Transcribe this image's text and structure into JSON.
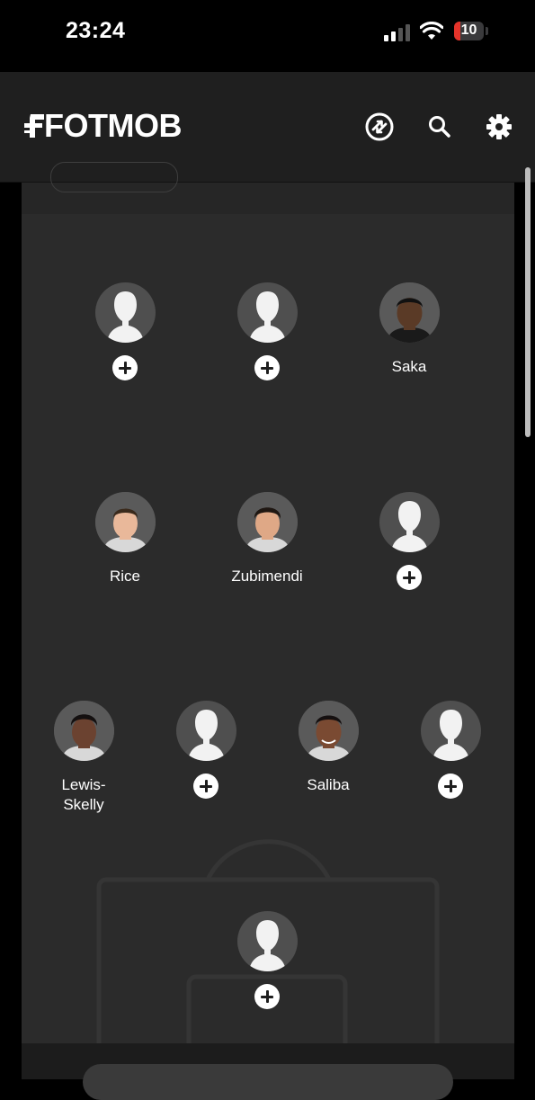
{
  "status_bar": {
    "time": "23:24",
    "battery_level": "10",
    "battery_color": "#e5332a",
    "signal_icon": "cellular-signal-icon",
    "wifi_icon": "wifi-icon"
  },
  "header": {
    "logo_text": "FOTMOB",
    "icons": [
      "transfer-swap-icon",
      "search-icon",
      "gear-icon"
    ]
  },
  "colors": {
    "background": "#000000",
    "header": "#1f1f1f",
    "pitch": "#2b2b2b",
    "avatar_placeholder": "#4f4f4f"
  },
  "lineup": {
    "attack": [
      {
        "name": "",
        "empty": true
      },
      {
        "name": "",
        "empty": true
      },
      {
        "name": "Saka",
        "empty": false,
        "skin": "#5a3a26"
      }
    ],
    "midfield": [
      {
        "name": "Rice",
        "empty": false,
        "skin": "#e9b89a"
      },
      {
        "name": "Zubimendi",
        "empty": false,
        "skin": "#dfa886"
      },
      {
        "name": "",
        "empty": true
      }
    ],
    "defence": [
      {
        "name": "Lewis-\nSkelly",
        "line1": "Lewis-",
        "line2": "Skelly",
        "empty": false,
        "skin": "#6b4230"
      },
      {
        "name": "",
        "empty": true
      },
      {
        "name": "Saliba",
        "empty": false,
        "skin": "#7a4a32"
      },
      {
        "name": "",
        "empty": true
      }
    ],
    "goalkeeper": [
      {
        "name": "",
        "empty": true
      }
    ]
  }
}
